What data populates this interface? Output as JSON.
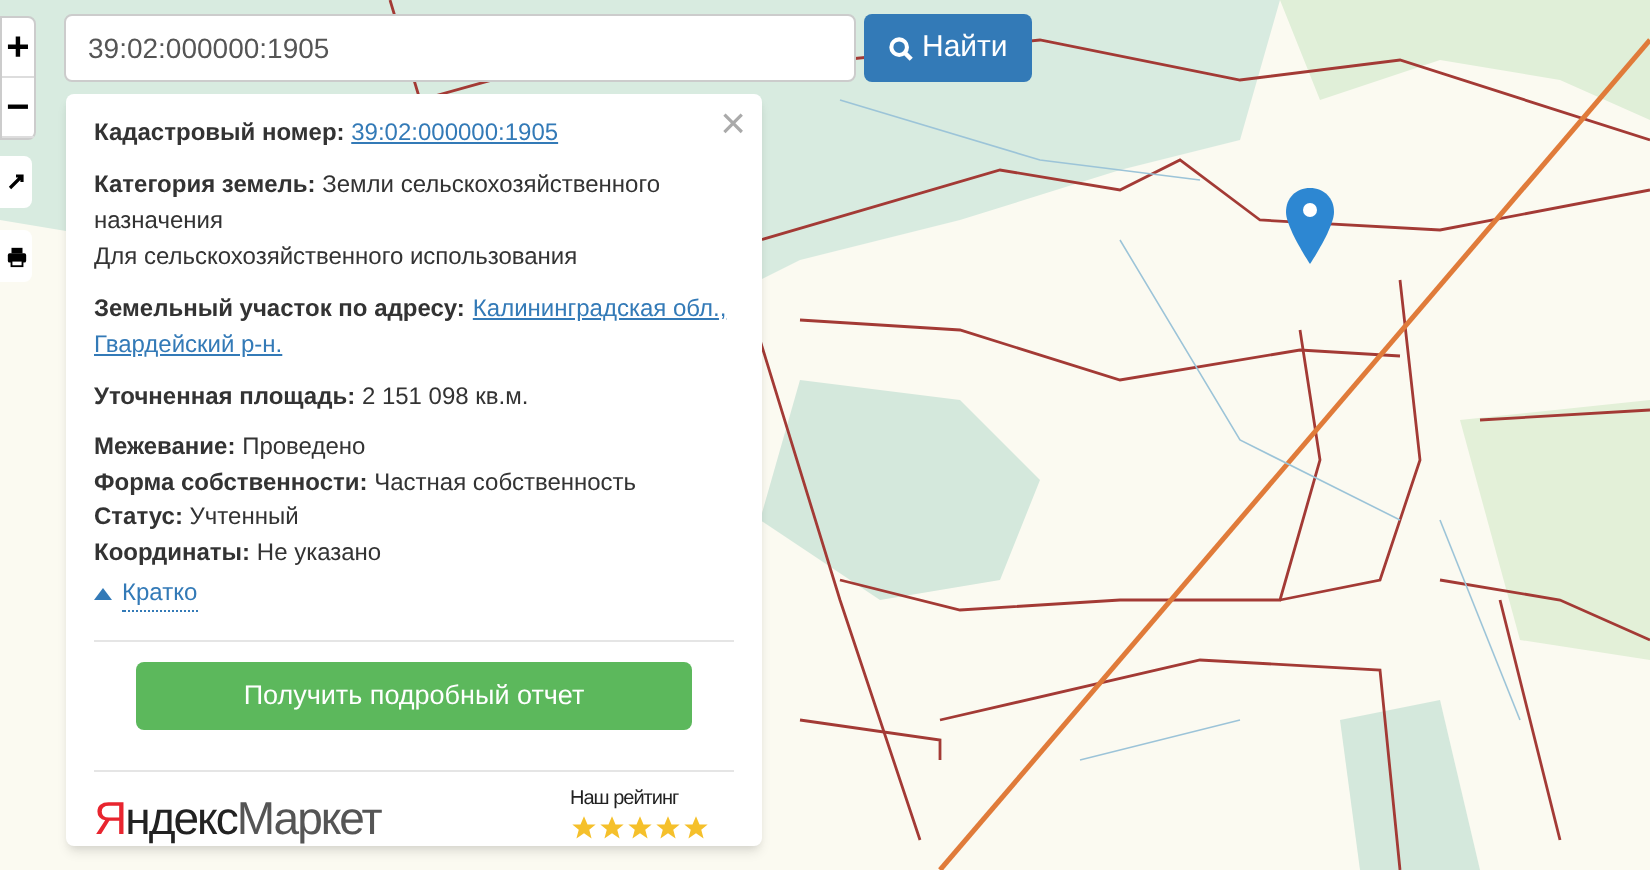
{
  "zoom_controls": [
    {
      "label": "+"
    },
    {
      "label": "−"
    }
  ],
  "search": {
    "value": "39:02:000000:1905",
    "button": "Найти"
  },
  "popup": {
    "close": "×",
    "cadastral": {
      "label": "Кадастровый номер:",
      "link": "39:02:000000:1905"
    },
    "category": {
      "label": "Категория земель:",
      "value": "Земли сельскохозяйственного назначения",
      "usage": "Для сельскохозяйственного использования"
    },
    "address": {
      "label": "Земельный участок по адресу:",
      "link_lines": [
        "Калининградская обл.,",
        "Гвардейский р-н."
      ]
    },
    "area": {
      "label": "Уточненная площадь:",
      "value": "2 151 098 кв.м."
    },
    "details": [
      {
        "label": "Межевание:",
        "value": "Проведено"
      },
      {
        "label": "Форма собственности:",
        "value": "Частная собственность"
      },
      {
        "label": "Статус:",
        "value": "Учтенный"
      },
      {
        "label": "Координаты:",
        "value": "Не указано"
      }
    ],
    "toggle": {
      "label": "Кратко",
      "expanded": true
    },
    "report_button": "Получить подробный отчет",
    "brand": {
      "red": "Я",
      "rest_bold": "ндекс",
      "rest": "Маркет"
    },
    "rating": {
      "label": "Наш рейтинг",
      "stars": 5
    }
  }
}
